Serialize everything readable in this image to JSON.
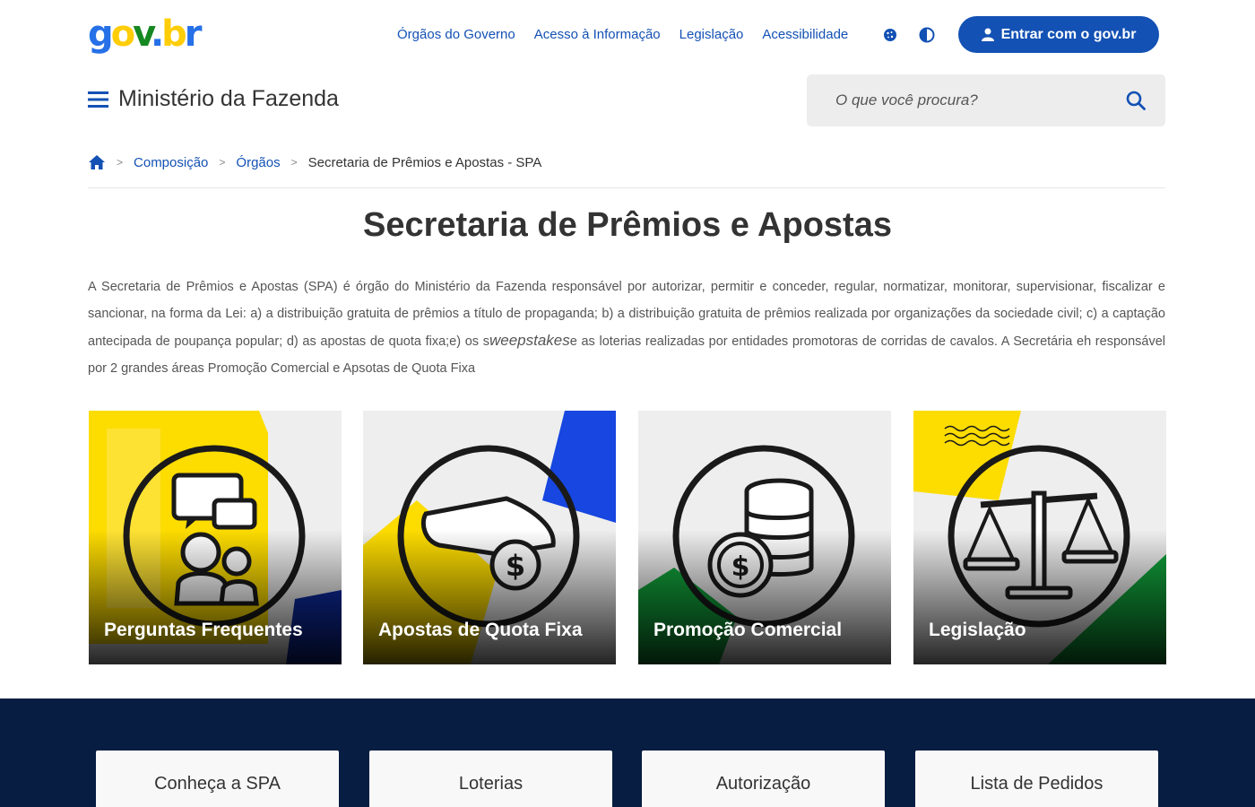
{
  "header": {
    "logo": {
      "g": "g",
      "o": "o",
      "v": "v",
      "dot": ".",
      "b": "b",
      "r": "r"
    },
    "links": [
      "Órgãos do Governo",
      "Acesso à Informação",
      "Legislação",
      "Acessibilidade"
    ],
    "login_label": "Entrar com o gov.br",
    "icons": {
      "cookie": "cookie-icon",
      "contrast": "contrast-icon",
      "user": "user-icon"
    }
  },
  "site": {
    "title": "Ministério da Fazenda",
    "search_placeholder": "O que você procura?"
  },
  "breadcrumb": {
    "items": [
      "Composição",
      "Órgãos"
    ],
    "current": "Secretaria de Prêmios e Apostas - SPA"
  },
  "page": {
    "title": "Secretaria de Prêmios e Apostas",
    "description_part1": "A Secretaria de Prêmios e Apostas (SPA) é órgão do Ministério da Fazenda responsável por autorizar, permitir e conceder, regular, normatizar, monitorar, supervisionar, fiscalizar e sancionar, na forma da Lei: a) a distribuição gratuita de prêmios a título de propaganda; b) a distribuição gratuita de prêmios realizada por organizações da sociedade civil; c) a captação antecipada de poupança popular; d) as apostas de quota fixa;e) os s",
    "description_em": "weepstakes",
    "description_part2": "e as loterias realizadas por entidades promotoras de corridas de cavalos. A Secretária eh responsável por 2 grandes áreas Promoção Comercial e Apsotas de Quota Fixa"
  },
  "cards": [
    {
      "label": "Perguntas Frequentes",
      "icon": "chat-people-icon"
    },
    {
      "label": "Apostas de Quota Fixa",
      "icon": "hand-coin-icon"
    },
    {
      "label": "Promoção Comercial",
      "icon": "coin-stack-icon"
    },
    {
      "label": "Legislação",
      "icon": "scales-icon"
    }
  ],
  "bottom_buttons": [
    "Conheça a SPA",
    "Loterias",
    "Autorização",
    "Lista de Pedidos"
  ],
  "colors": {
    "primary": "#1351b4",
    "navy": "#071d41",
    "yellow": "#ffcd07",
    "green": "#168821"
  }
}
